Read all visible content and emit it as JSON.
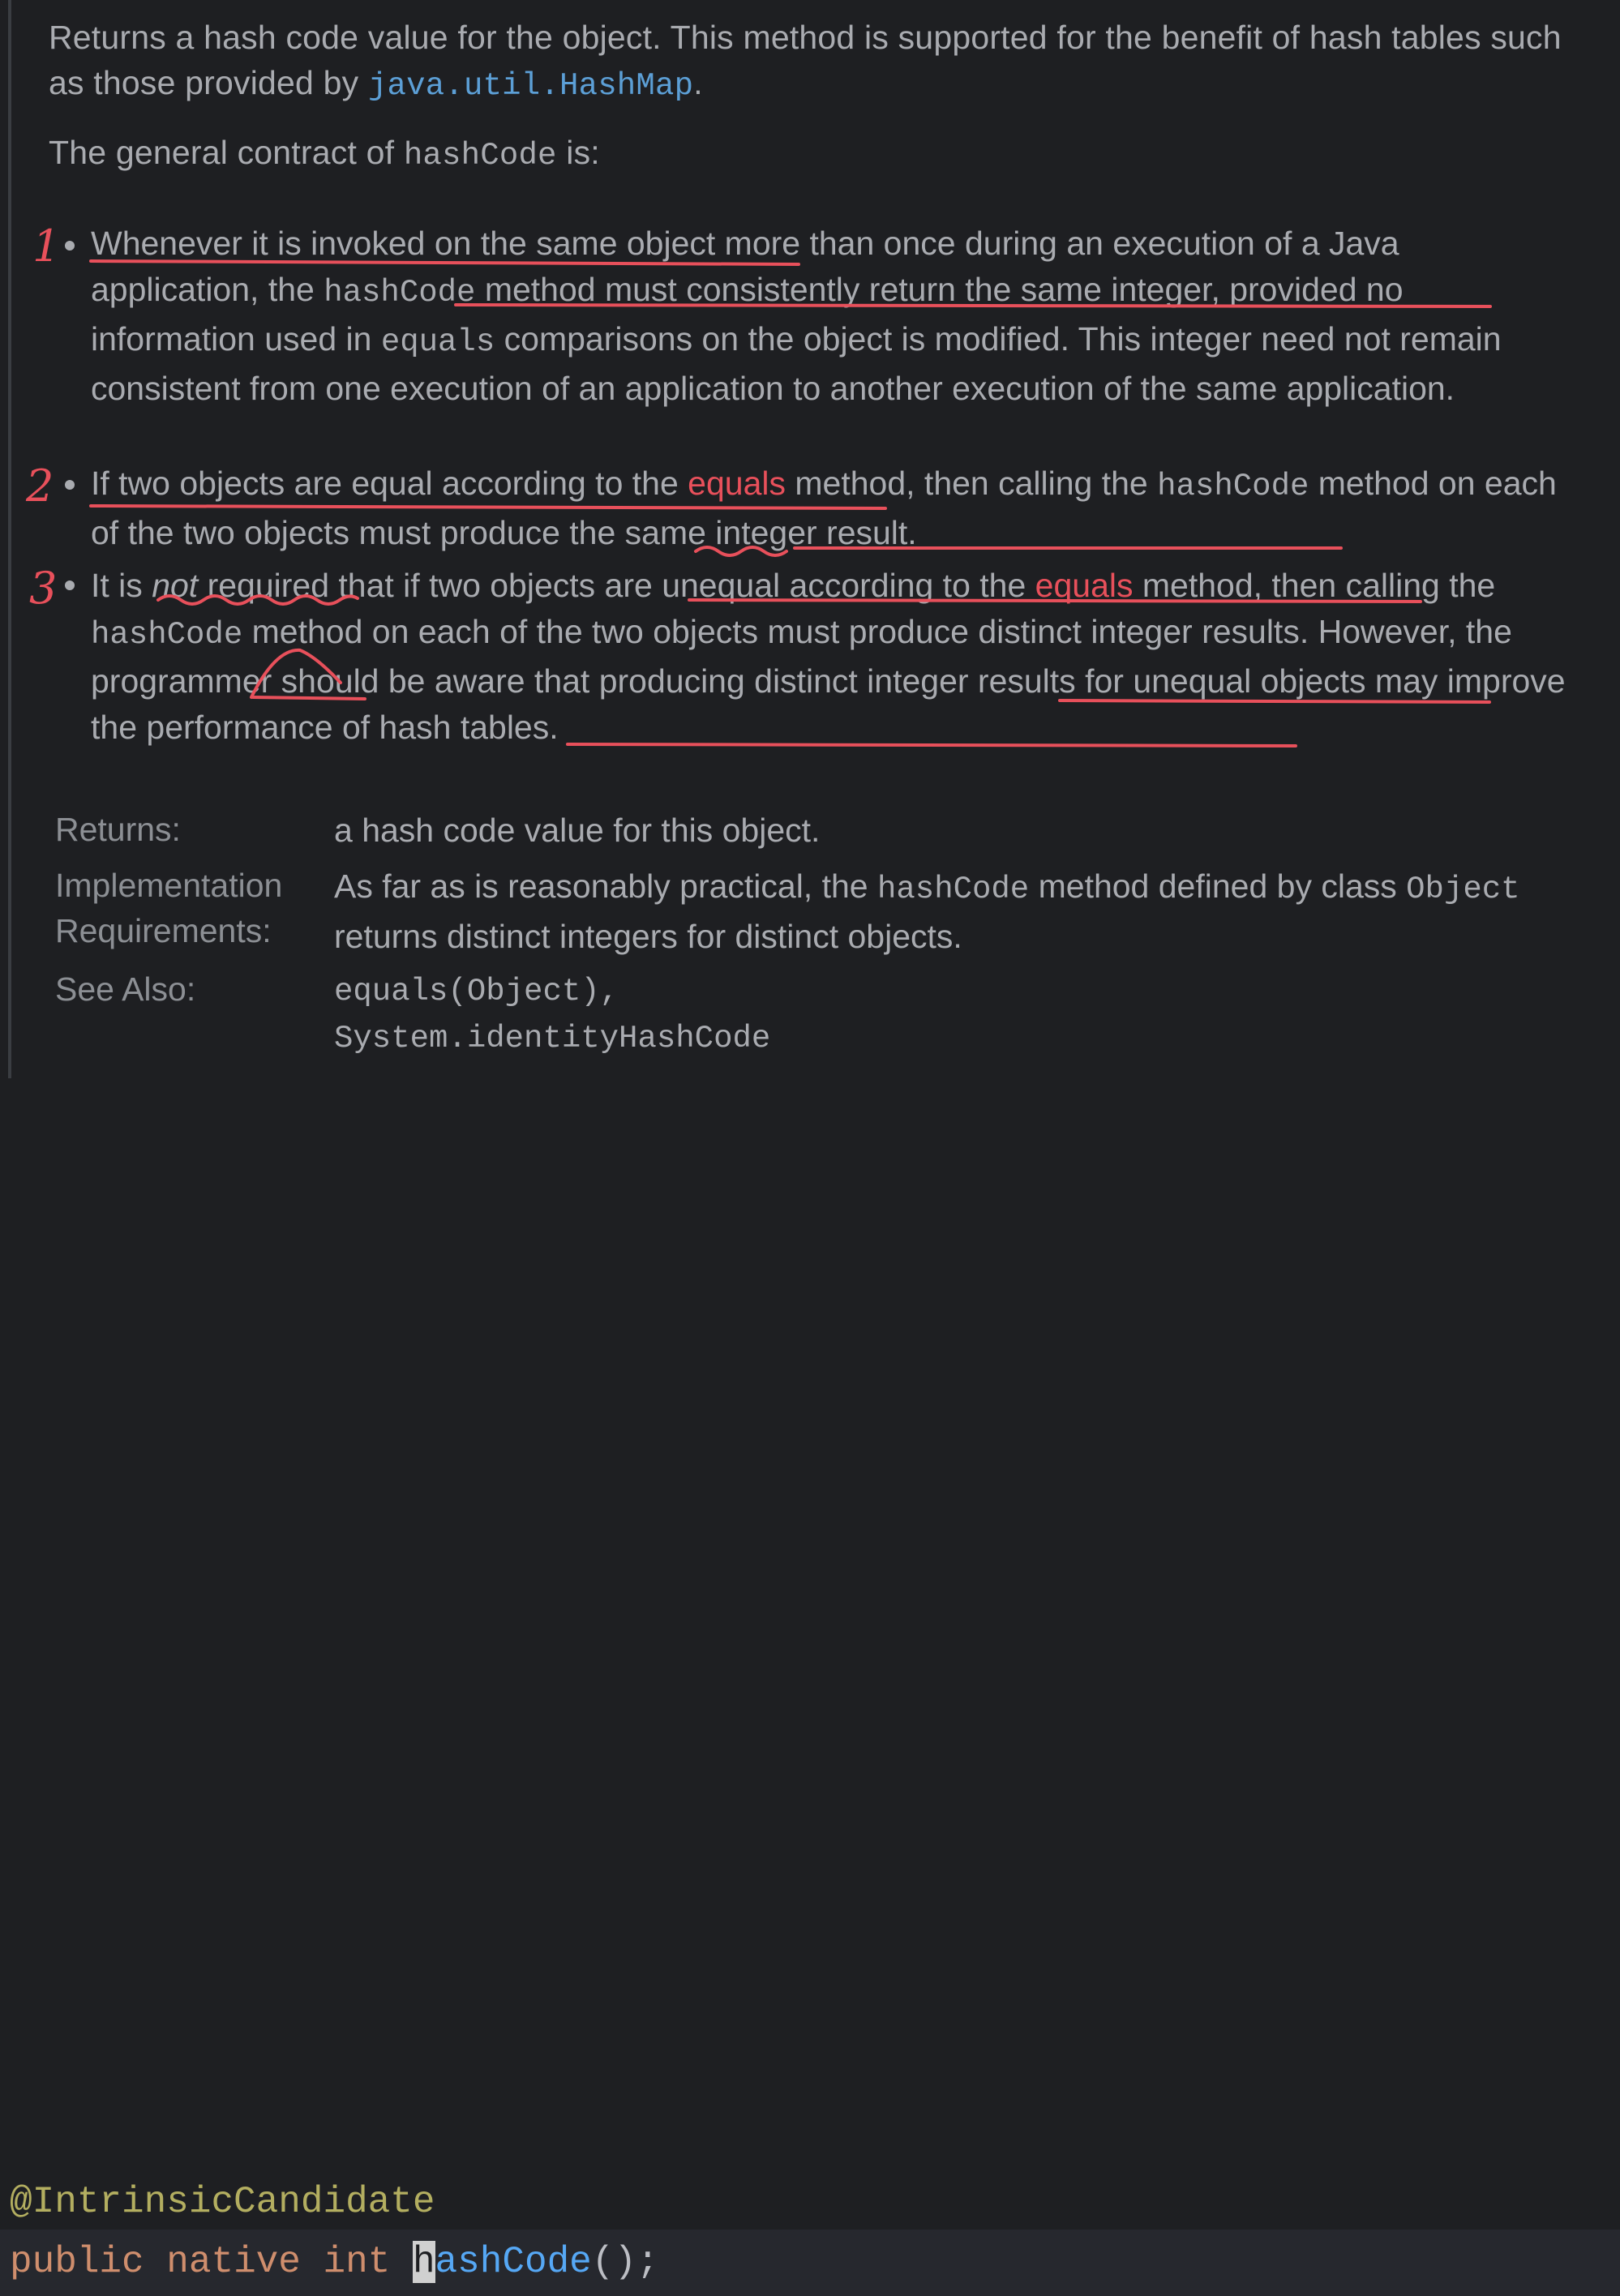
{
  "doc": {
    "intro_before_link": "Returns a hash code value for the object. This method is supported for the benefit of hash tables such as those provided by ",
    "intro_link": "java.util.HashMap",
    "intro_after_link": ".",
    "contract_before": "The general contract of ",
    "contract_code": "hashCode",
    "contract_after": " is:",
    "bullets": [
      {
        "number": "1",
        "text_html_parts": {
          "p1": "Whenever it is invoked on the same object more than once during an execution of a Java application, the ",
          "p2": "hashCode",
          "p3": " method must consistently return the same integer, provided no information used in ",
          "p4": "equals",
          "p5": " comparisons on the object is modified. This integer need not remain consistent from one execution of an application to another execution of the same application."
        }
      },
      {
        "number": "2",
        "text_html_parts": {
          "p1": "If two objects are equal according to the ",
          "p2": "equals",
          "p3": " method, then calling the ",
          "p4": "hashCode",
          "p5": " method on each of the two objects must produce the same integer result."
        }
      },
      {
        "number": "3",
        "text_html_parts": {
          "p1": "It is ",
          "p2": "not",
          "p3": " required that if two objects are unequal according to the ",
          "p4": "equals",
          "p5": " method, then calling the ",
          "p6": "hashCode",
          "p7": " method on each of the two objects must produce distinct integer results. However, the programmer should be aware that producing distinct integer results for unequal objects may improve the performance of hash tables."
        }
      }
    ],
    "returns_label": "Returns:",
    "returns_value": "a hash code value for this object.",
    "impl_label_1": "Implementation",
    "impl_label_2": "Requirements:",
    "impl_value_p1": "As far as is reasonably practical, the ",
    "impl_value_code1": "hashCode",
    "impl_value_p2": " method defined by class ",
    "impl_value_code2": "Object",
    "impl_value_p3": " returns distinct integers for distinct objects.",
    "see_also_label": "See Also:",
    "see_also_links": [
      "equals(Object),",
      "System.identityHashCode"
    ]
  },
  "code": {
    "annotation": "@IntrinsicCandidate",
    "kw_public": "public",
    "kw_native": "native",
    "kw_int": "int",
    "method_first": "h",
    "method_rest": "ashCode",
    "tail": "();"
  },
  "colors": {
    "background": "#1e1f22",
    "text": "#a9abb0",
    "link": "#5c9fd6",
    "annotation_red": "#e8505b",
    "annotation_code": "#b3ae60",
    "keyword": "#cf8e6d"
  }
}
